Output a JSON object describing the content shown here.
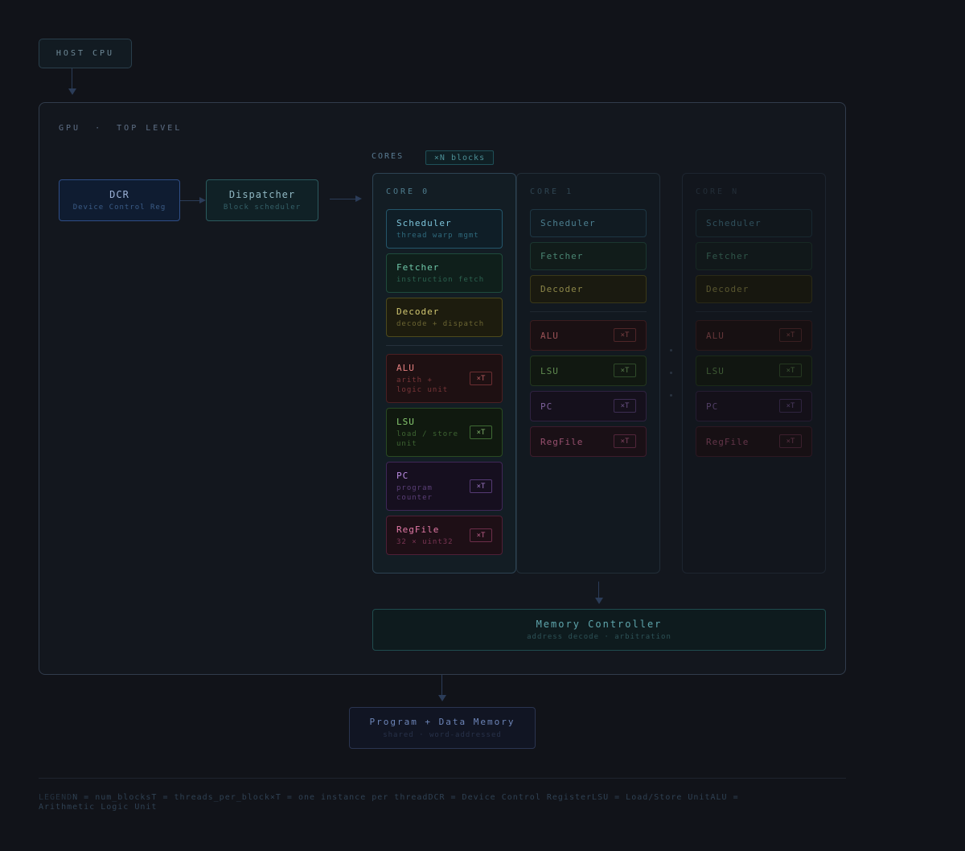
{
  "host": {
    "label": "HOST CPU"
  },
  "gpu": {
    "title": "GPU  ·  TOP LEVEL"
  },
  "dcr": {
    "name": "DCR",
    "desc": "Device Control Reg"
  },
  "dispatcher": {
    "name": "Dispatcher",
    "desc": "Block scheduler"
  },
  "cores": {
    "label": "CORES",
    "badge": "×N blocks"
  },
  "core0": {
    "label": "CORE 0",
    "units": [
      {
        "name": "Scheduler",
        "desc": "thread warp mgmt"
      },
      {
        "name": "Fetcher",
        "desc": "instruction fetch"
      },
      {
        "name": "Decoder",
        "desc": "decode + dispatch"
      },
      {
        "name": "ALU",
        "desc": "arith + logic unit",
        "badge": "×T"
      },
      {
        "name": "LSU",
        "desc": "load / store unit",
        "badge": "×T"
      },
      {
        "name": "PC",
        "desc": "program counter",
        "badge": "×T"
      },
      {
        "name": "RegFile",
        "desc": "32 × uint32",
        "badge": "×T"
      }
    ]
  },
  "core1": {
    "label": "CORE 1",
    "units": [
      {
        "name": "Scheduler"
      },
      {
        "name": "Fetcher"
      },
      {
        "name": "Decoder"
      },
      {
        "name": "ALU",
        "badge": "×T"
      },
      {
        "name": "LSU",
        "badge": "×T"
      },
      {
        "name": "PC",
        "badge": "×T"
      },
      {
        "name": "RegFile",
        "badge": "×T"
      }
    ]
  },
  "coreN": {
    "label": "CORE N",
    "units": [
      {
        "name": "Scheduler"
      },
      {
        "name": "Fetcher"
      },
      {
        "name": "Decoder"
      },
      {
        "name": "ALU",
        "badge": "×T"
      },
      {
        "name": "LSU",
        "badge": "×T"
      },
      {
        "name": "PC",
        "badge": "×T"
      },
      {
        "name": "RegFile",
        "badge": "×T"
      }
    ]
  },
  "memory_controller": {
    "name": "Memory Controller",
    "desc": "address decode · arbitration"
  },
  "program_memory": {
    "name": "Program + Data Memory",
    "desc": "shared · word-addressed"
  },
  "legend": {
    "title": "LEGEND",
    "items": [
      "N = num_blocks",
      "T = threads_per_block",
      "×T = one instance per thread",
      "DCR = Device Control Register",
      "LSU = Load/Store Unit",
      "ALU = Arithmetic Logic Unit"
    ]
  },
  "colors": {
    "background": "#111319",
    "scheduler": "#0f1e27",
    "fetcher": "#0f1f1b",
    "decoder": "#1d1c0e",
    "alu": "#1e1012",
    "lsu": "#10190f",
    "pc": "#160f1f",
    "regfile": "#1e0f16"
  }
}
